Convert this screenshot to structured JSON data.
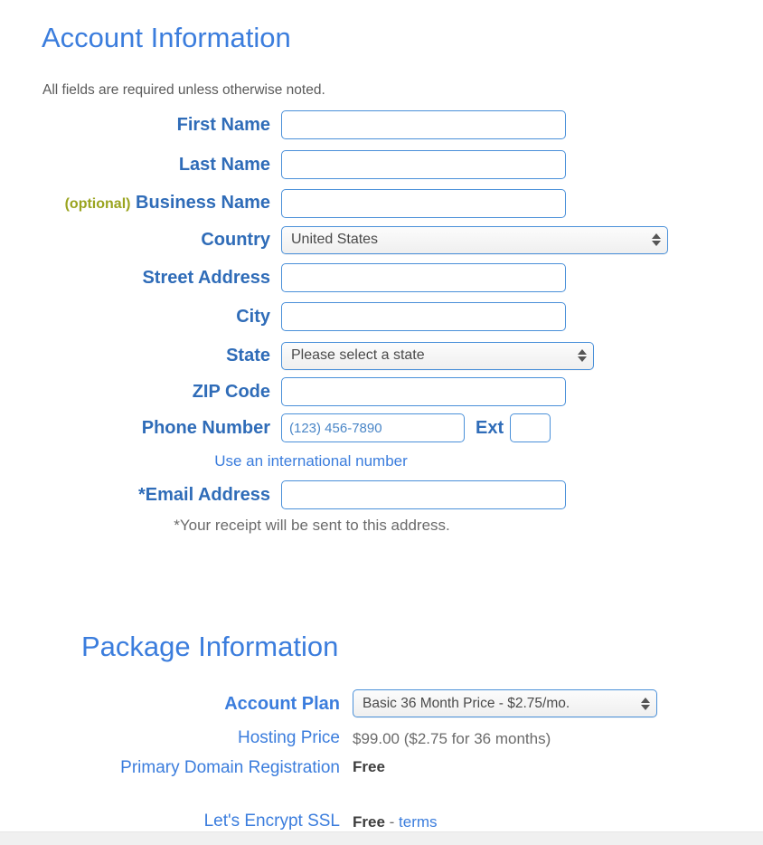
{
  "account": {
    "heading": "Account Information",
    "subnote": "All fields are required unless otherwise noted.",
    "fields": {
      "first_name": {
        "label": "First Name",
        "value": "",
        "placeholder": ""
      },
      "last_name": {
        "label": "Last Name",
        "value": "",
        "placeholder": ""
      },
      "business_name": {
        "optional_tag": "(optional)",
        "label": "Business Name",
        "value": "",
        "placeholder": ""
      },
      "country": {
        "label": "Country",
        "selected": "United States"
      },
      "street_address": {
        "label": "Street Address",
        "value": "",
        "placeholder": ""
      },
      "city": {
        "label": "City",
        "value": "",
        "placeholder": ""
      },
      "state": {
        "label": "State",
        "selected": "Please select a state"
      },
      "zip_code": {
        "label": "ZIP Code",
        "value": "",
        "placeholder": ""
      },
      "phone": {
        "label": "Phone Number",
        "value": "",
        "placeholder": "(123) 456-7890",
        "ext_label": "Ext",
        "ext_value": "",
        "helper_link": "Use an international number"
      },
      "email": {
        "label": "*Email Address",
        "value": "",
        "placeholder": "",
        "note": "*Your receipt will be sent to this address."
      }
    }
  },
  "package": {
    "heading": "Package Information",
    "rows": [
      {
        "label": "Account Plan",
        "selected": "Basic 36 Month Price - $2.75/mo."
      },
      {
        "label": "Hosting Price",
        "value": "$99.00  ($2.75 for 36 months)"
      },
      {
        "label": "Primary Domain Registration",
        "value": "Free"
      },
      {
        "label": "Let's Encrypt SSL",
        "value": "Free",
        "separator": "-",
        "link": "terms"
      }
    ]
  },
  "icons": {
    "stepper": "up-down-stepper-icon"
  },
  "colors": {
    "heading_blue": "#3b7ddd",
    "label_blue": "#2f6cb8",
    "optional_olive": "#9aa41f",
    "input_border": "#4a90d9",
    "value_gray": "#6b6b6b",
    "page_background": "#ffffff"
  }
}
